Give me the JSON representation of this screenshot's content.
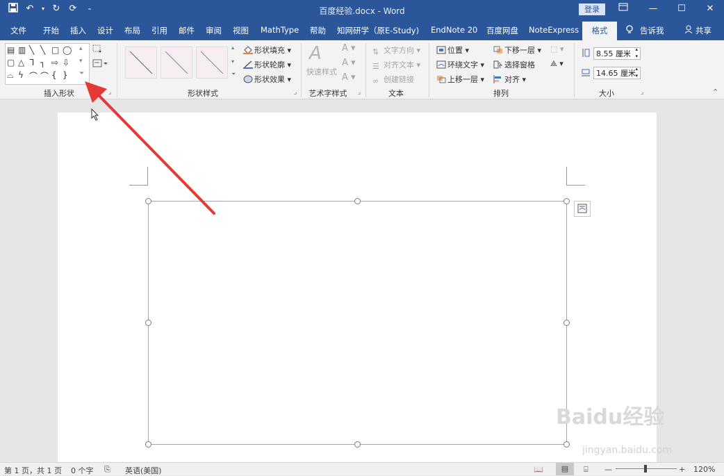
{
  "titlebar": {
    "title": "百度经验.docx - Word",
    "login": "登录"
  },
  "tabs": [
    "文件",
    "开始",
    "插入",
    "设计",
    "布局",
    "引用",
    "邮件",
    "审阅",
    "视图",
    "MathType",
    "帮助",
    "知网研学（原E-Study)",
    "EndNote 20",
    "百度网盘",
    "NoteExpress"
  ],
  "active_tab": "格式",
  "tell_me": "告诉我",
  "share": "共享",
  "ribbon": {
    "groups": {
      "insert_shapes": "插入形状",
      "shape_styles": "形状样式",
      "wordart_styles": "艺术字样式",
      "text": "文本",
      "arrange": "排列",
      "size": "大小"
    },
    "shape_fill": "形状填充",
    "shape_outline": "形状轮廓",
    "shape_effects": "形状效果",
    "quick_styles": "快速样式",
    "text_direction": "文字方向",
    "align_text": "对齐文本",
    "create_link": "创建链接",
    "position": "位置",
    "wrap_text": "环绕文字",
    "bring_forward": "上移一层",
    "send_backward": "下移一层",
    "selection_pane": "选择窗格",
    "align": "对齐",
    "height": "8.55 厘米",
    "width": "14.65 厘米"
  },
  "statusbar": {
    "page": "第 1 页，共 1 页",
    "words": "0 个字",
    "language": "英语(美国)",
    "zoom": "120%"
  },
  "watermark": {
    "brand": "Baidu经验",
    "url": "jingyan.baidu.com"
  }
}
